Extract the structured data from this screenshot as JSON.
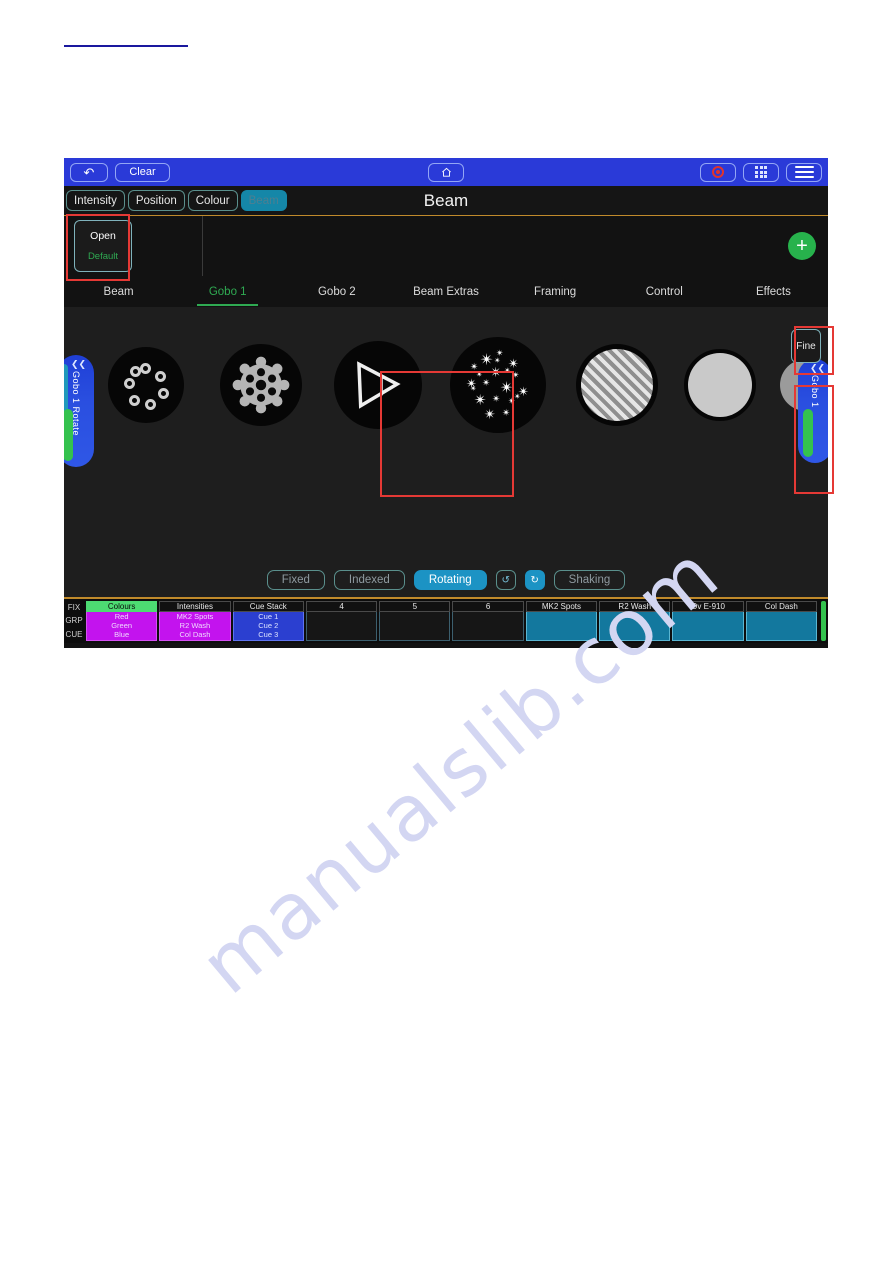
{
  "page": {
    "watermark": "manualslib.com"
  },
  "topbar": {
    "back_icon": "back-arrow-icon",
    "clear_label": "Clear",
    "home_icon": "home-icon",
    "record_icon": "record-icon",
    "grid_icon": "grid-icon",
    "menu_icon": "hamburger-menu-icon"
  },
  "attributes": {
    "title": "Beam",
    "buttons": [
      {
        "label": "Intensity",
        "active": false
      },
      {
        "label": "Position",
        "active": false
      },
      {
        "label": "Colour",
        "active": false
      },
      {
        "label": "Beam",
        "active": true
      }
    ]
  },
  "palette": {
    "cell": {
      "title": "Open",
      "sub": "Default"
    },
    "add_label": "+"
  },
  "tabs": [
    {
      "label": "Beam",
      "active": false
    },
    {
      "label": "Gobo 1",
      "active": true
    },
    {
      "label": "Gobo 2",
      "active": false
    },
    {
      "label": "Beam Extras",
      "active": false
    },
    {
      "label": "Framing",
      "active": false
    },
    {
      "label": "Control",
      "active": false
    },
    {
      "label": "Effects",
      "active": false
    }
  ],
  "stage": {
    "left_slider_label": "Gobo 1 Rotate",
    "right_slider_label": "Gobo 1",
    "fine_label": "Fine",
    "gobos": [
      {
        "name": "gobo-dots",
        "selected": false
      },
      {
        "name": "gobo-gear",
        "selected": false
      },
      {
        "name": "gobo-triangle",
        "selected": false
      },
      {
        "name": "gobo-stars",
        "selected": true
      },
      {
        "name": "gobo-stripes",
        "selected": false
      },
      {
        "name": "gobo-solid",
        "selected": false
      },
      {
        "name": "gobo-grey",
        "selected": false
      }
    ],
    "modes": [
      {
        "label": "Fixed",
        "active": false
      },
      {
        "label": "Indexed",
        "active": false
      },
      {
        "label": "Rotating",
        "active": true
      },
      {
        "label": "Shaking",
        "active": false
      }
    ],
    "rotation_buttons": [
      {
        "name": "rotate-ccw-icon",
        "glyph": "↺",
        "active": false
      },
      {
        "name": "rotate-cw-icon",
        "glyph": "↻",
        "active": true
      }
    ]
  },
  "bottom": {
    "row_labels": [
      "FIX",
      "GRP",
      "CUE"
    ],
    "columns": [
      {
        "header": "Colours",
        "head_style": "green",
        "body_style": "magenta",
        "cells": [
          "Red",
          "Green",
          "Blue"
        ]
      },
      {
        "header": "Intensities",
        "head_style": "dark",
        "body_style": "magenta",
        "cells": [
          "MK2 Spots",
          "R2 Wash",
          "Col Dash"
        ]
      },
      {
        "header": "Cue Stack",
        "head_style": "dark",
        "body_style": "blue",
        "cells": [
          "Cue 1",
          "Cue 2",
          "Cue 3"
        ]
      },
      {
        "header": "4",
        "head_style": "dark",
        "body_style": "dark",
        "cells": []
      },
      {
        "header": "5",
        "head_style": "dark",
        "body_style": "dark",
        "cells": []
      },
      {
        "header": "6",
        "head_style": "dark",
        "body_style": "dark",
        "cells": []
      },
      {
        "header": "MK2 Spots",
        "head_style": "dark",
        "body_style": "teal",
        "cells": []
      },
      {
        "header": "R2 Wash",
        "head_style": "dark",
        "body_style": "teal",
        "cells": []
      },
      {
        "header": "Ov E-910",
        "head_style": "dark",
        "body_style": "teal",
        "cells": []
      },
      {
        "header": "Col Dash",
        "head_style": "dark",
        "body_style": "teal",
        "cells": []
      }
    ]
  },
  "colors": {
    "accent_blue": "#2a3ad8",
    "active_teal": "#1587a8",
    "tab_active_green": "#2faa52",
    "annotation_red": "#e53935",
    "orange_rule": "#c08a2b",
    "magenta_cell": "#c313ee",
    "teal_cell": "#13789e"
  }
}
